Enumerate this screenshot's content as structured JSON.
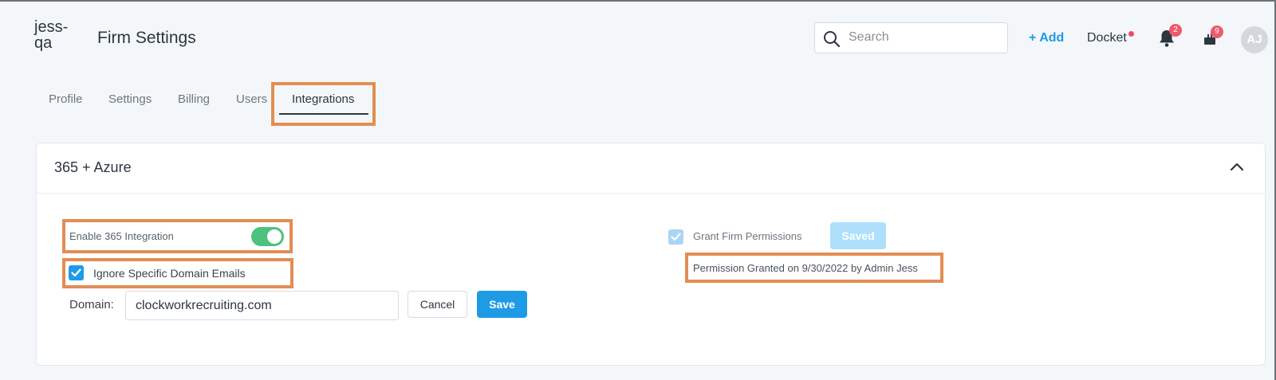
{
  "header": {
    "firm_name": "jess-qa",
    "title": "Firm Settings",
    "search_placeholder": "Search",
    "add_label": "+ Add",
    "docket_label": "Docket",
    "notifications_count": "2",
    "tasks_count": "9",
    "avatar_initials": "AJ"
  },
  "tabs": [
    {
      "label": "Profile"
    },
    {
      "label": "Settings"
    },
    {
      "label": "Billing"
    },
    {
      "label": "Users"
    },
    {
      "label": "Integrations",
      "active": true
    }
  ],
  "card": {
    "title": "365 + Azure",
    "enable_label": "Enable 365 Integration",
    "enable_on": true,
    "ignore_label": "Ignore Specific Domain Emails",
    "ignore_checked": true,
    "domain_label": "Domain:",
    "domain_value": "clockworkrecruiting.com",
    "cancel_label": "Cancel",
    "save_label": "Save",
    "grant_label": "Grant Firm Permissions",
    "saved_label": "Saved",
    "granted_text": "Permission Granted on 9/30/2022 by Admin Jess"
  },
  "colors": {
    "accent": "#1f9be6",
    "toggle_on": "#4cc27d",
    "badge": "#ef5a6a",
    "highlight": "#e38d54"
  }
}
